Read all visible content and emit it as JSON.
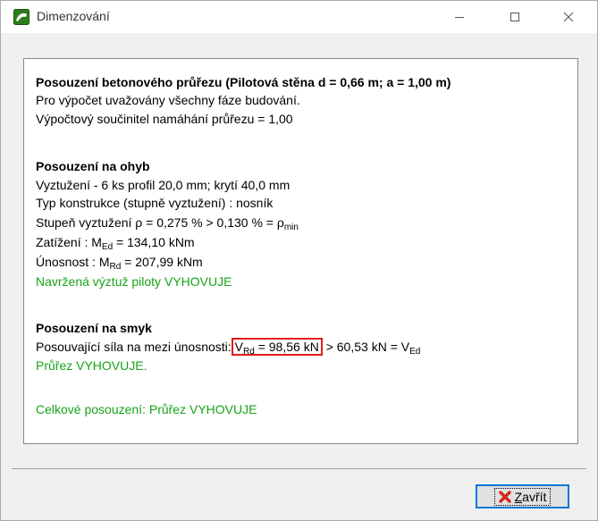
{
  "window": {
    "title": "Dimenzování",
    "controls": {
      "minimize": "—",
      "maximize": "☐",
      "close": "✕"
    }
  },
  "report": {
    "header": "Posouzení betonového průřezu (Pilotová stěna d = 0,66 m; a = 1,00 m)",
    "phases": "Pro výpočet uvažovány všechny fáze budování.",
    "factor": "Výpočtový součinitel namáhání průřezu = 1,00",
    "bending": {
      "title": "Posouzení na ohyb",
      "reinforcement": "Vyztužení - 6 ks profil 20,0 mm; krytí 40,0 mm",
      "construction_type": "Typ konstrukce (stupně vyztužení) : nosník",
      "ratio_text": "Stupeň vyztužení ρ = 0,275 % > 0,130 % = ρ",
      "ratio_sub": "min",
      "load_prefix": "Zatížení : M",
      "load_sub": "Ed",
      "load_value": " = 134,10 kNm",
      "capacity_prefix": "Únosnost : M",
      "capacity_sub": "Rd",
      "capacity_value": " = 207,99 kNm",
      "result": "Navržená výztuž piloty VYHOVUJE"
    },
    "shear": {
      "title": "Posouzení na smyk",
      "prefix": "Posouvající síla na mezi únosnosti:",
      "vrd_symbol": "V",
      "vrd_sub": "Rd",
      "vrd_value": " = 98,56 kN",
      "compare": " > 60,53 kN = V",
      "ved_sub": "Ed",
      "result": "Průřez VYHOVUJE."
    },
    "overall": "Celkové posouzení: Průřez VYHOVUJE"
  },
  "footer": {
    "close_label_first": "Z",
    "close_label_rest": "avřít"
  },
  "colors": {
    "ok_green": "#17a317",
    "highlight_red": "#e01b1b",
    "close_icon_red": "#d7261e",
    "focus_blue": "#0078d7"
  }
}
